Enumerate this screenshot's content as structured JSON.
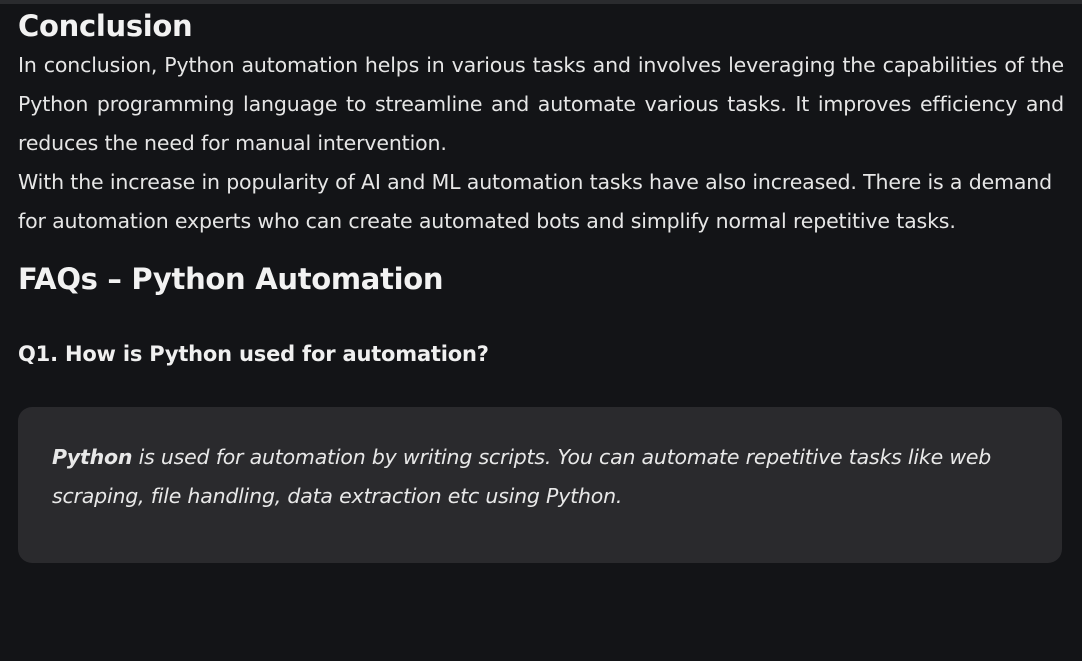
{
  "conclusion": {
    "heading": "Conclusion",
    "paragraph_1": "In conclusion, Python automation helps in various tasks and involves leveraging the capabilities of the Python programming language to streamline and automate various tasks. It improves efficiency and reduces the need for manual intervention.",
    "paragraph_2": "With the increase in popularity of AI and ML automation tasks have also increased. There is a demand for automation experts who can create automated bots and simplify normal repetitive tasks."
  },
  "faqs": {
    "heading": "FAQs – Python Automation",
    "items": [
      {
        "question": "Q1. How is Python used for automation?",
        "answer_bold": "Python",
        "answer_rest": " is used for automation by writing scripts. You can automate repetitive tasks like web scraping, file handling, data extraction etc using Python."
      }
    ]
  },
  "colors": {
    "background": "#131417",
    "answer_box": "#2a2a2d",
    "text": "#e6e6e6"
  }
}
